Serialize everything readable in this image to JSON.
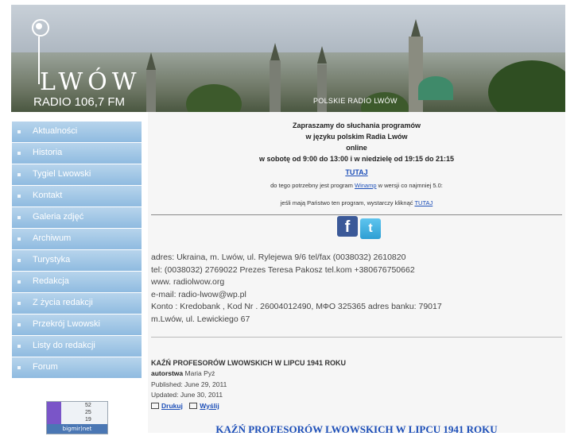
{
  "header": {
    "logo_name": "LWÓW",
    "logo_freq": "RADIO 106,7 FM",
    "caption": "POLSKIE RADIO LWÓW"
  },
  "sidebar": {
    "items": [
      {
        "label": "Aktualności"
      },
      {
        "label": "Historia"
      },
      {
        "label": "Tygiel Lwowski"
      },
      {
        "label": "Kontakt"
      },
      {
        "label": "Galeria zdjęć"
      },
      {
        "label": "Archiwum"
      },
      {
        "label": "Turystyka"
      },
      {
        "label": "Redakcja"
      },
      {
        "label": "Z życia redakcji"
      },
      {
        "label": "Przekrój Lwowski"
      },
      {
        "label": "Listy do redakcji"
      },
      {
        "label": "Forum"
      }
    ],
    "counter": {
      "row1": "52",
      "row2": "25",
      "row3": "19",
      "brand": "bigmir)net"
    }
  },
  "promo": {
    "line1": "Zapraszamy do słuchania programów",
    "line2": "w języku polskim Radia Lwów",
    "line3": "online",
    "line4": "w sobotę od 9:00 do 13:00 i w niedzielę od 19:15 do 21:15",
    "link1": "TUTAJ",
    "small1_pre": "do tego potrzebny jest program ",
    "small1_link": "Winamp",
    "small1_post": " w wersji co najmniej 5.0:",
    "small2_pre": "jeśli mają Państwo ten program, wystarczy kliknąć ",
    "small2_link": "TUTAJ"
  },
  "social": {
    "facebook": "f",
    "twitter": "t"
  },
  "contact": {
    "lines": [
      "adres: Ukraina, m. Lwów, ul. Rylejewa 9/6 tel/fax (0038032) 2610820",
      "tel: (0038032) 2769022 Prezes Teresa Pakosz tel.kom +380676750662",
      "www. radiolwow.org",
      "e-mail: radio-lwow@wp.pl",
      "Konto : Kredobank , Kod Nr . 26004012490, МФО 325365 adres banku: 79017",
      "m.Lwów, ul. Lewickiego 67"
    ]
  },
  "article": {
    "title": "KAŹŃ PROFESORÓW LWOWSKICH W LIPCU 1941 ROKU",
    "author_label": "autorstwa",
    "author": "Maria Pyż",
    "published": "Published: June 29, 2011",
    "updated": "Updated: June 30, 2011",
    "print": "Drukuj",
    "send": "Wyślij",
    "big_title": "KAŹŃ PROFESORÓW LWOWSKICH W LIPCU 1941 ROKU"
  }
}
